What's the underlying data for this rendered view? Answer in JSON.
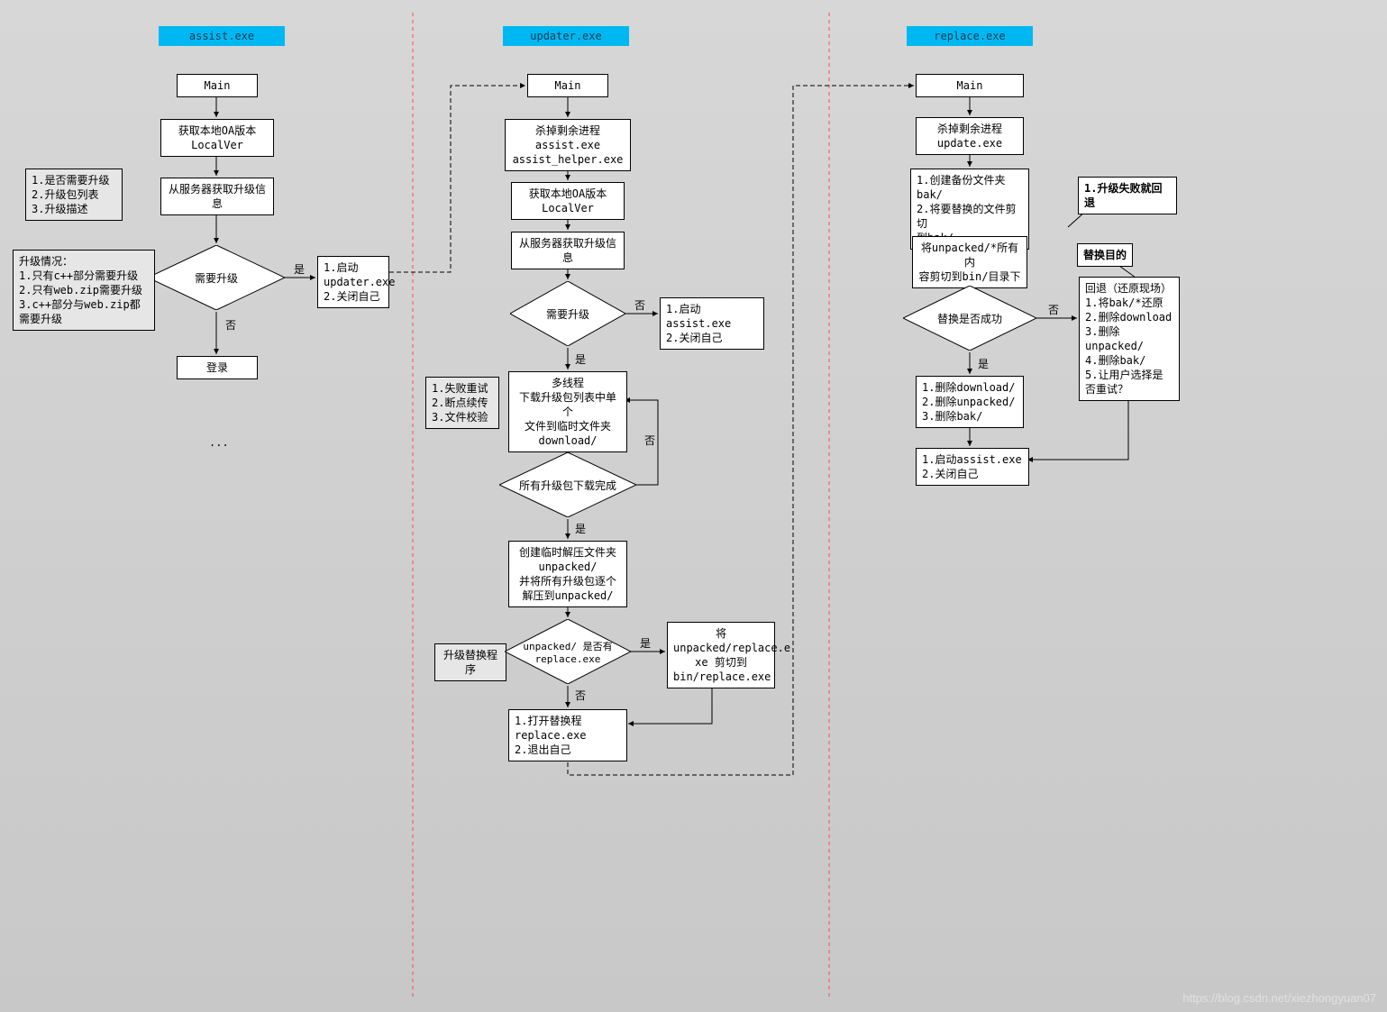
{
  "headers": {
    "assist": "assist.exe",
    "updater": "updater.exe",
    "replace": "replace.exe"
  },
  "assist": {
    "main": "Main",
    "getver": "获取本地OA版本\nLocalVer",
    "fetch": "从服务器获取升级信\n息",
    "need": "需要升级",
    "start": "1.启动\nupdater.exe\n2.关闭自己",
    "login": "登录",
    "note_check": "1.是否需要升级\n2.升级包列表\n3.升级描述",
    "note_cases": "升级情况：\n1.只有c++部分需要升级\n2.只有web.zip需要升级\n3.c++部分与web.zip都需要升级",
    "dots": "...",
    "yes_a": "是",
    "no_a": "否"
  },
  "updater": {
    "main": "Main",
    "kill": "杀掉剩余进程\nassist.exe\nassist_helper.exe",
    "getver": "获取本地OA版本\nLocalVer",
    "fetch": "从服务器获取升级信\n息",
    "need": "需要升级",
    "noNeed": "1.启动assist.exe\n2.关闭自己",
    "download": "多线程\n下载升级包列表中单个\n文件到临时文件夹\ndownload/",
    "note_dl": "1.失败重试\n2.断点续传\n3.文件校验",
    "allDone": "所有升级包下载完成",
    "unpack": "创建临时解压文件夹\nunpacked/\n并将所有升级包逐个\n解压到unpacked/",
    "note_rep": "升级替换程序",
    "hasReplace": "unpacked/ 是否有\nreplace.exe",
    "moveReplace": "将\nunpacked/replace.e\nxe 剪切到\nbin/replace.exe",
    "openReplace": "1.打开替换程replace.exe\n2.退出自己",
    "yes_to_dl": "是",
    "yes_allDone": "是",
    "no_allDone": "否",
    "no_need": "否",
    "has_yes": "是",
    "has_no": "否"
  },
  "replace": {
    "main": "Main",
    "kill": "杀掉剩余进程\nupdate.exe",
    "backup": "1.创建备份文件夹bak/\n2.将要替换的文件剪切\n到bak/",
    "move": "将unpacked/*所有内\n容剪切到bin/目录下",
    "ok": "替换是否成功",
    "clean": "1.删除download/\n2.删除unpacked/\n3.删除bak/",
    "restart": "1.启动assist.exe\n2.关闭自己",
    "callout_fail": "1.升级失败就回退",
    "callout_goal": "替换目的",
    "rollback": "回退（还原现场）\n1.将bak/*还原\n2.删除download\n3.删除unpacked/\n4.删除bak/\n5.让用户选择是\n否重试？",
    "ok_yes": "是",
    "ok_no": "否"
  },
  "watermark": "https://blog.csdn.net/xiezhongyuan07"
}
